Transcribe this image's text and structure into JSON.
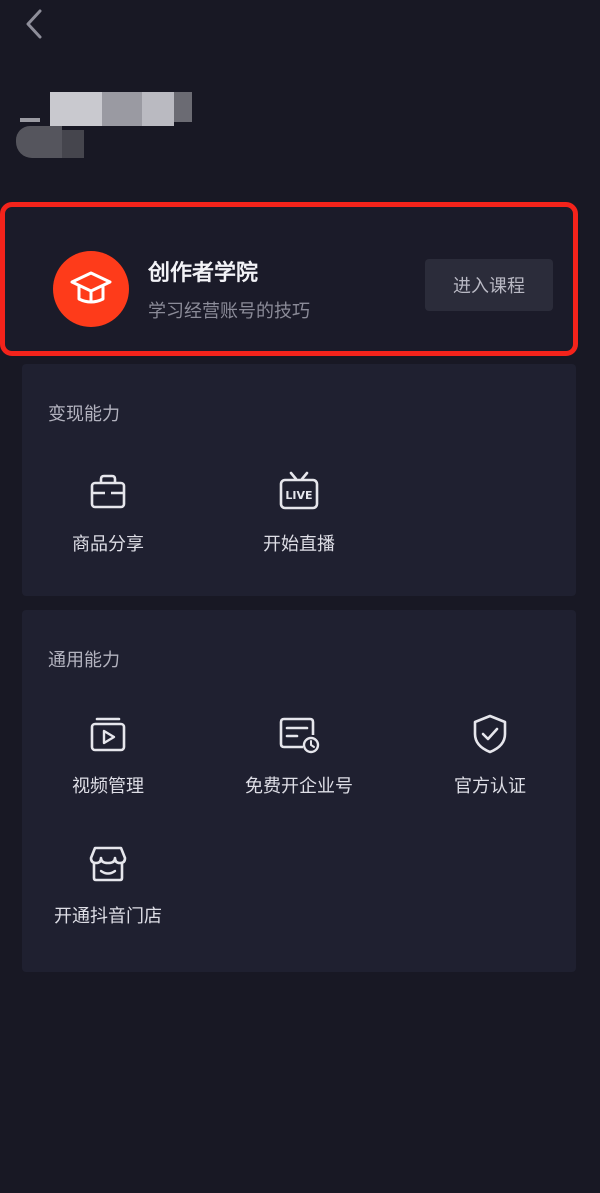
{
  "academy": {
    "title": "创作者学院",
    "subtitle": "学习经营账号的技巧",
    "button_label": "进入课程"
  },
  "monetization": {
    "title": "变现能力",
    "items": [
      {
        "label": "商品分享",
        "icon": "shopping-bag-icon"
      },
      {
        "label": "开始直播",
        "icon": "live-tv-icon",
        "icon_text": "LIVE"
      }
    ]
  },
  "general": {
    "title": "通用能力",
    "items": [
      {
        "label": "视频管理",
        "icon": "video-folder-icon"
      },
      {
        "label": "免费开企业号",
        "icon": "business-card-icon"
      },
      {
        "label": "官方认证",
        "icon": "verified-shield-icon"
      },
      {
        "label": "开通抖音门店",
        "icon": "storefront-icon"
      }
    ]
  },
  "colors": {
    "background": "#181824",
    "card": "#1f2030",
    "accent": "#fe3b1a",
    "highlight_border": "#f4231b"
  }
}
